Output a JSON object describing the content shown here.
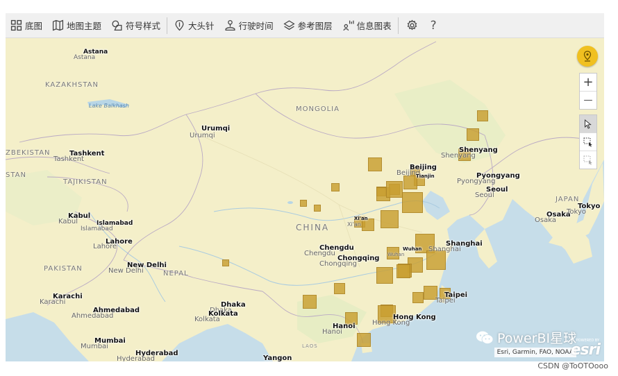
{
  "toolbar": {
    "items": [
      {
        "label": "底图",
        "icon": "basemap-grid-icon"
      },
      {
        "label": "地图主题",
        "icon": "map-theme-icon"
      },
      {
        "label": "符号样式",
        "icon": "symbol-style-icon"
      },
      {
        "label": "大头针",
        "icon": "pin-icon"
      },
      {
        "label": "行驶时间",
        "icon": "drive-time-icon"
      },
      {
        "label": "参考图层",
        "icon": "reference-layer-icon"
      },
      {
        "label": "信息图表",
        "icon": "infographic-icon"
      }
    ],
    "settings_icon": "gear-icon",
    "help_label": "?"
  },
  "map": {
    "countries": {
      "kazakhstan": "KAZAKHSTAN",
      "mongolia": "MONGOLIA",
      "uzbekistan": "ZBEKISTAN",
      "tajikistan": "TAJIKISTAN",
      "china": "CHINA",
      "pakistan": "PAKISTAN",
      "nepal": "NEPAL",
      "japan": "JAPAN",
      "laos": "LAOS",
      "stan_fragment": "STAN"
    },
    "water": {
      "lake_balkhash": "Lake Balkhash"
    },
    "cities": {
      "astana": "Astana",
      "urumqi": "Urumqi",
      "tashkent": "Tashkent",
      "kabul": "Kabul",
      "islamabad": "Islamabad",
      "lahore": "Lahore",
      "new_delhi": "New Delhi",
      "karachi": "Karachi",
      "ahmedabad": "Ahmedabad",
      "mumbai": "Mumbai",
      "hyderabad": "Hyderabad",
      "dhaka": "Dhaka",
      "kolkata": "Kolkata",
      "yangon": "Yangon",
      "hanoi": "Hanoi",
      "hong_kong": "Hong Kong",
      "taipei": "Taipei",
      "shanghai": "Shanghai",
      "wuhan": "Wuhan",
      "chengdu": "Chengdu",
      "chongqing": "Chongqing",
      "xian": "Xi'an",
      "beijing": "Beijing",
      "tianjin": "Tianjin",
      "shenyang": "Shenyang",
      "pyongyang": "Pyongyang",
      "seoul": "Seoul",
      "osaka": "Osaka",
      "tokyo": "Tokyo"
    },
    "controls": {
      "zoom_in": "+",
      "zoom_out": "—",
      "locate_icon": "location-pin-icon",
      "select_icon": "cursor-select-icon",
      "rect_select_icon": "rectangle-select-icon",
      "lasso_icon": "lasso-select-icon"
    },
    "attribution": "Esri, Garmin, FAO, NOAA",
    "esri_logo": "esri",
    "esri_powered": "POWERED BY",
    "bubble_color": "#c89e30",
    "bubbles": [
      {
        "size": 0.45
      },
      {
        "size": 0.5
      },
      {
        "size": 0.5
      },
      {
        "size": 0.35
      },
      {
        "size": 0.6
      },
      {
        "size": 0.4
      },
      {
        "size": 0.55
      },
      {
        "size": 0.45
      },
      {
        "size": 0.25
      },
      {
        "size": 0.2
      },
      {
        "size": 0.2
      },
      {
        "size": 0.3
      },
      {
        "size": 0.55
      },
      {
        "size": 0.75
      },
      {
        "size": 1.0
      },
      {
        "size": 0.85
      },
      {
        "size": 0.4
      },
      {
        "size": 0.5
      },
      {
        "size": 0.9
      },
      {
        "size": 0.95
      },
      {
        "size": 0.65
      },
      {
        "size": 0.5
      },
      {
        "size": 0.75
      },
      {
        "size": 0.6
      },
      {
        "size": 0.55
      },
      {
        "size": 0.6
      },
      {
        "size": 0.45
      },
      {
        "size": 0.5
      },
      {
        "size": 0.8
      },
      {
        "size": 0.5
      },
      {
        "size": 0.4
      },
      {
        "size": 0.6
      },
      {
        "size": 0.2
      },
      {
        "size": 0.55
      },
      {
        "size": 0.45
      }
    ]
  },
  "watermark": {
    "text": "PowerBI星球",
    "icon": "wechat-icon"
  },
  "credit": "CSDN @ToOTOooo"
}
